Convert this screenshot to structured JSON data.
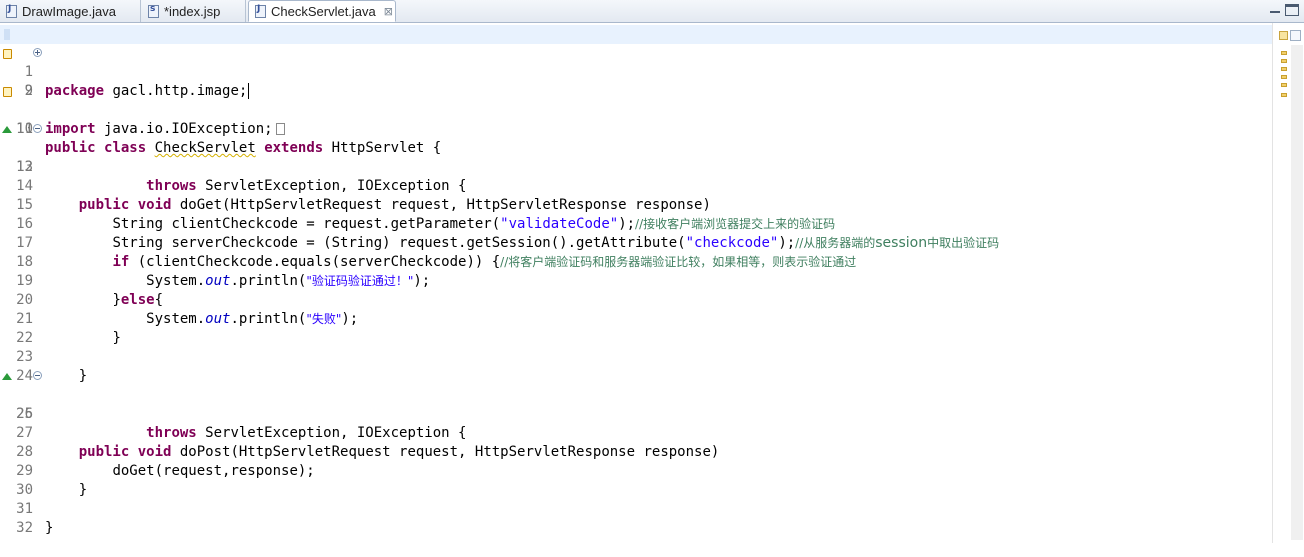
{
  "tabs": [
    {
      "label": "DrawImage.java",
      "icon": "java-file-icon",
      "active": false
    },
    {
      "label": "*index.jsp",
      "icon": "jsp-file-icon",
      "active": false
    },
    {
      "label": "CheckServlet.java",
      "icon": "java-file-icon",
      "active": true,
      "close": "⊠"
    }
  ],
  "editor": {
    "current_line": 1,
    "lines": [
      {
        "num": "1",
        "code": "package gacl.http.image;"
      },
      {
        "num": "2",
        "code": "import java.io.IOException;"
      },
      {
        "num": "9",
        "code": ""
      },
      {
        "num": "10",
        "code": "public class CheckServlet extends HttpServlet {"
      },
      {
        "num": "11",
        "code": ""
      },
      {
        "num": "12",
        "code": "    public void doGet(HttpServletRequest request, HttpServletResponse response)"
      },
      {
        "num": "13",
        "code": "            throws ServletException, IOException {"
      },
      {
        "num": "14",
        "code": ""
      },
      {
        "num": "15",
        "code": "        String clientCheckcode = request.getParameter(\"validateCode\");//接收客户端浏览器提交上来的验证码"
      },
      {
        "num": "16",
        "code": "        String serverCheckcode = (String) request.getSession().getAttribute(\"checkcode\");//从服务器端的session中取出验证码"
      },
      {
        "num": "17",
        "code": "        if (clientCheckcode.equals(serverCheckcode)) {//将客户端验证码和服务器端验证比较，如果相等，则表示验证通过"
      },
      {
        "num": "18",
        "code": "            System.out.println(\"验证码验证通过！\");"
      },
      {
        "num": "19",
        "code": "        }else{"
      },
      {
        "num": "20",
        "code": "            System.out.println(\"失败\");"
      },
      {
        "num": "21",
        "code": "        }"
      },
      {
        "num": "22",
        "code": ""
      },
      {
        "num": "23",
        "code": "    }"
      },
      {
        "num": "24",
        "code": ""
      },
      {
        "num": "25",
        "code": "    public void doPost(HttpServletRequest request, HttpServletResponse response)"
      },
      {
        "num": "26",
        "code": "            throws ServletException, IOException {"
      },
      {
        "num": "27",
        "code": ""
      },
      {
        "num": "28",
        "code": "        doGet(request,response);"
      },
      {
        "num": "29",
        "code": "    }"
      },
      {
        "num": "30",
        "code": ""
      },
      {
        "num": "31",
        "code": "}"
      },
      {
        "num": "32",
        "code": ""
      }
    ]
  },
  "tokens": {
    "l1": {
      "kw": "package",
      "rest": " gacl.http.image;"
    },
    "l2": {
      "kw": "import",
      "rest": " java.io.IOException;"
    },
    "l10": {
      "kw1": "public",
      "kw2": "class",
      "name": "CheckServlet",
      "kw3": "extends",
      "rest": " HttpServlet {"
    },
    "l12": {
      "kw1": "public",
      "kw2": "void",
      "rest": " doGet(HttpServletRequest request, HttpServletResponse response)"
    },
    "l13": {
      "kw": "throws",
      "rest": " ServletException, IOException {"
    },
    "l15": {
      "pre": "String clientCheckcode = request.getParameter(",
      "str": "\"validateCode\"",
      "post": ");",
      "cm": "//接收客户端浏览器提交上来的验证码"
    },
    "l16": {
      "pre": "String serverCheckcode = (String) request.getSession().getAttribute(",
      "str": "\"checkcode\"",
      "post": ");",
      "cm1": "//从服务器端的",
      "cm2": "session",
      "cm3": "中取出验证码"
    },
    "l17": {
      "kw": "if",
      "rest": " (clientCheckcode.equals(serverCheckcode)) {",
      "cm": "//将客户端验证码和服务器端验证比较，如果相等，则表示验证通过"
    },
    "l18": {
      "pre": "System.",
      "it": "out",
      "mid": ".println(",
      "str": "\"验证码验证通过！\"",
      "post": ");"
    },
    "l19": {
      "pre": "}",
      "kw": "else",
      "post": "{"
    },
    "l20": {
      "pre": "System.",
      "it": "out",
      "mid": ".println(",
      "str": "\"失败\"",
      "post": ");"
    },
    "l21": "}",
    "l23": "}",
    "l25": {
      "kw1": "public",
      "kw2": "void",
      "rest": " doPost(HttpServletRequest request, HttpServletResponse response)"
    },
    "l26": {
      "kw": "throws",
      "rest": " ServletException, IOException {"
    },
    "l28": "doGet(request,response);",
    "l29": "}",
    "l31": "}"
  },
  "colors": {
    "keyword": "#7f0055",
    "string": "#2a00ff",
    "comment": "#3f7f5f",
    "static_field": "#0000c0",
    "line_number": "#787878",
    "current_line": "#e8f2fe"
  }
}
